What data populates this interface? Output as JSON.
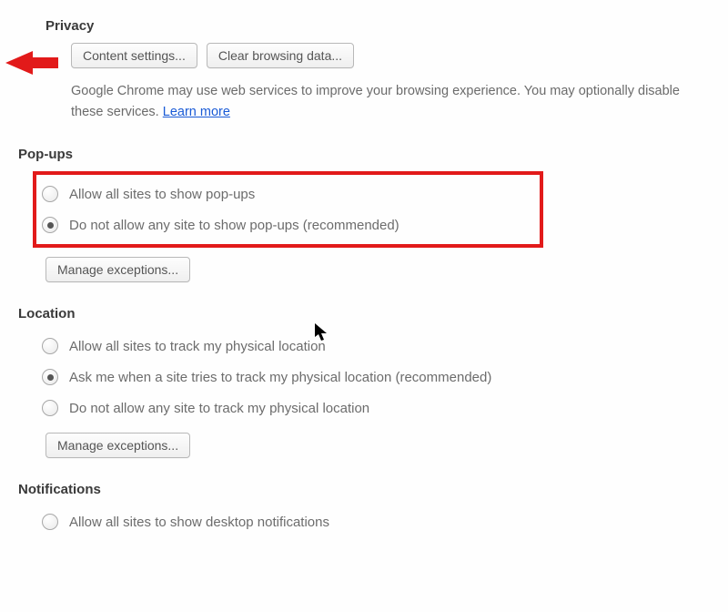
{
  "privacy": {
    "title": "Privacy",
    "content_settings_label": "Content settings...",
    "clear_browsing_label": "Clear browsing data...",
    "desc_part1": "Google Chrome may use web services to improve your browsing experience. You may optionally disable these services. ",
    "learn_more": "Learn more"
  },
  "popups": {
    "title": "Pop-ups",
    "option_allow": "Allow all sites to show pop-ups",
    "option_block": "Do not allow any site to show pop-ups (recommended)",
    "selected": "block",
    "manage_label": "Manage exceptions..."
  },
  "location": {
    "title": "Location",
    "option_allow": "Allow all sites to track my physical location",
    "option_ask": "Ask me when a site tries to track my physical location (recommended)",
    "option_block": "Do not allow any site to track my physical location",
    "selected": "ask",
    "manage_label": "Manage exceptions..."
  },
  "notifications": {
    "title": "Notifications",
    "option_allow": "Allow all sites to show desktop notifications"
  },
  "colors": {
    "highlight": "#e21a1a",
    "link": "#1a5bd6"
  }
}
